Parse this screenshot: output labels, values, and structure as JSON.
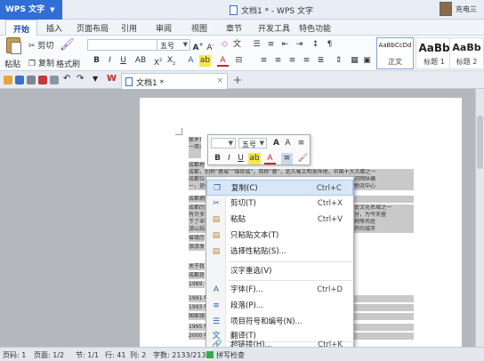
{
  "titlebar": {
    "app_name": "WPS 文字",
    "doc_title": "文档1 * - WPS 文字",
    "user_name": "充电三"
  },
  "menu": {
    "tabs": [
      "开始",
      "插入",
      "页面布局",
      "引用",
      "审阅",
      "视图",
      "章节",
      "开发工具",
      "特色功能"
    ]
  },
  "ribbon": {
    "paste": "粘贴",
    "cut": "剪切",
    "copy": "复制",
    "format_painter": "格式刷",
    "font_name": "",
    "font_size": "五号",
    "styles": [
      {
        "sample": "AaBbCcDd",
        "label": "正文"
      },
      {
        "sample": "AaBb",
        "label": "标题 1"
      },
      {
        "sample": "AaBb",
        "label": "标题 2"
      }
    ]
  },
  "doctabs": {
    "active": "文档1 *",
    "add": "+"
  },
  "document": {
    "lines": [
      "家乡世界",
      "    一简介",
      "",
      "成都地处",
      "成都，别称“蓉城”“锦官城”，简称“蓉”，是古蜀文明发祥地，中国十大古都之一",
      "成都位于四川省中部，四川盆地西部，成都平原腹地，境内地势平坦、河网纵横",
      "一，是中国西部重要的中心城市，国家重要的高新技术产业基地、商贸物流中心",
      "         成都拥有历史文化名城，截至目前已有4500年城市文明史，是中国十",
      "成都历史悠久，文化底蕴深厚，自古享有“天府之国”的美誉，是国家历史文化名城之一",
      "有许多古蹟与文化遗址，是古蜀文明的发祥地，中华文明的重要组成部分，为今天留",
      "下了丰富的历史和文化遗产，至今成都仍保存着宽窄巷子、锦里、武侯祠等名胜",
      "游山玩水，让成都成为了一座休闲之都，美食之都，一座来了就不想离开的城市",
      "省级历史文化名城",
      "旅游发展",
      "",
      "关于我是成都人",
      "成都是我的家乡",
      "1989 年，我出生在这里",
      "1991 年，我开始在这里读书，走过了成都的大街小巷",
      "1993 年，我和家人一起去都江堰游玩",
      "国家级非物质文化遗产",
      "1995 年，中国家乡的历史：成都的古名是“蓉城”，芙蓉花开满城",
      "2000 年，成都的变化越来越大，我也慢慢长大了"
    ]
  },
  "minitoolbar": {
    "font_size": "五号",
    "grow": "A",
    "shrink": "A",
    "bold": "B",
    "italic": "I",
    "underline": "U"
  },
  "contextmenu": {
    "items": [
      {
        "icon": "copy-icon",
        "label": "复制(C)",
        "shortcut": "Ctrl+C"
      },
      {
        "icon": "cut-icon",
        "label": "剪切(T)",
        "shortcut": "Ctrl+X"
      },
      {
        "icon": "paste-icon",
        "label": "粘贴",
        "shortcut": "Ctrl+V"
      },
      {
        "icon": "paste-text-icon",
        "label": "只粘贴文本(T)",
        "shortcut": ""
      },
      {
        "icon": "paste-special-icon",
        "label": "选择性粘贴(S)...",
        "shortcut": ""
      },
      {
        "icon": "",
        "label": "汉字重选(V)",
        "shortcut": ""
      },
      {
        "icon": "font-icon",
        "label": "字体(F)...",
        "shortcut": "Ctrl+D"
      },
      {
        "icon": "paragraph-icon",
        "label": "段落(P)...",
        "shortcut": ""
      },
      {
        "icon": "list-icon",
        "label": "项目符号和编号(N)...",
        "shortcut": ""
      },
      {
        "icon": "translate-icon",
        "label": "翻译(T)",
        "shortcut": ""
      },
      {
        "icon": "hyperlink-icon",
        "label": "超链接(H)...",
        "shortcut": "Ctrl+K"
      }
    ]
  },
  "statusbar": {
    "page_no": "页码: 1",
    "pages": "页面: 1/2",
    "section": "节: 1/1",
    "row": "行: 41",
    "col": "列: 2",
    "words": "字数: 2133/2133",
    "spell": "拼写检查"
  }
}
